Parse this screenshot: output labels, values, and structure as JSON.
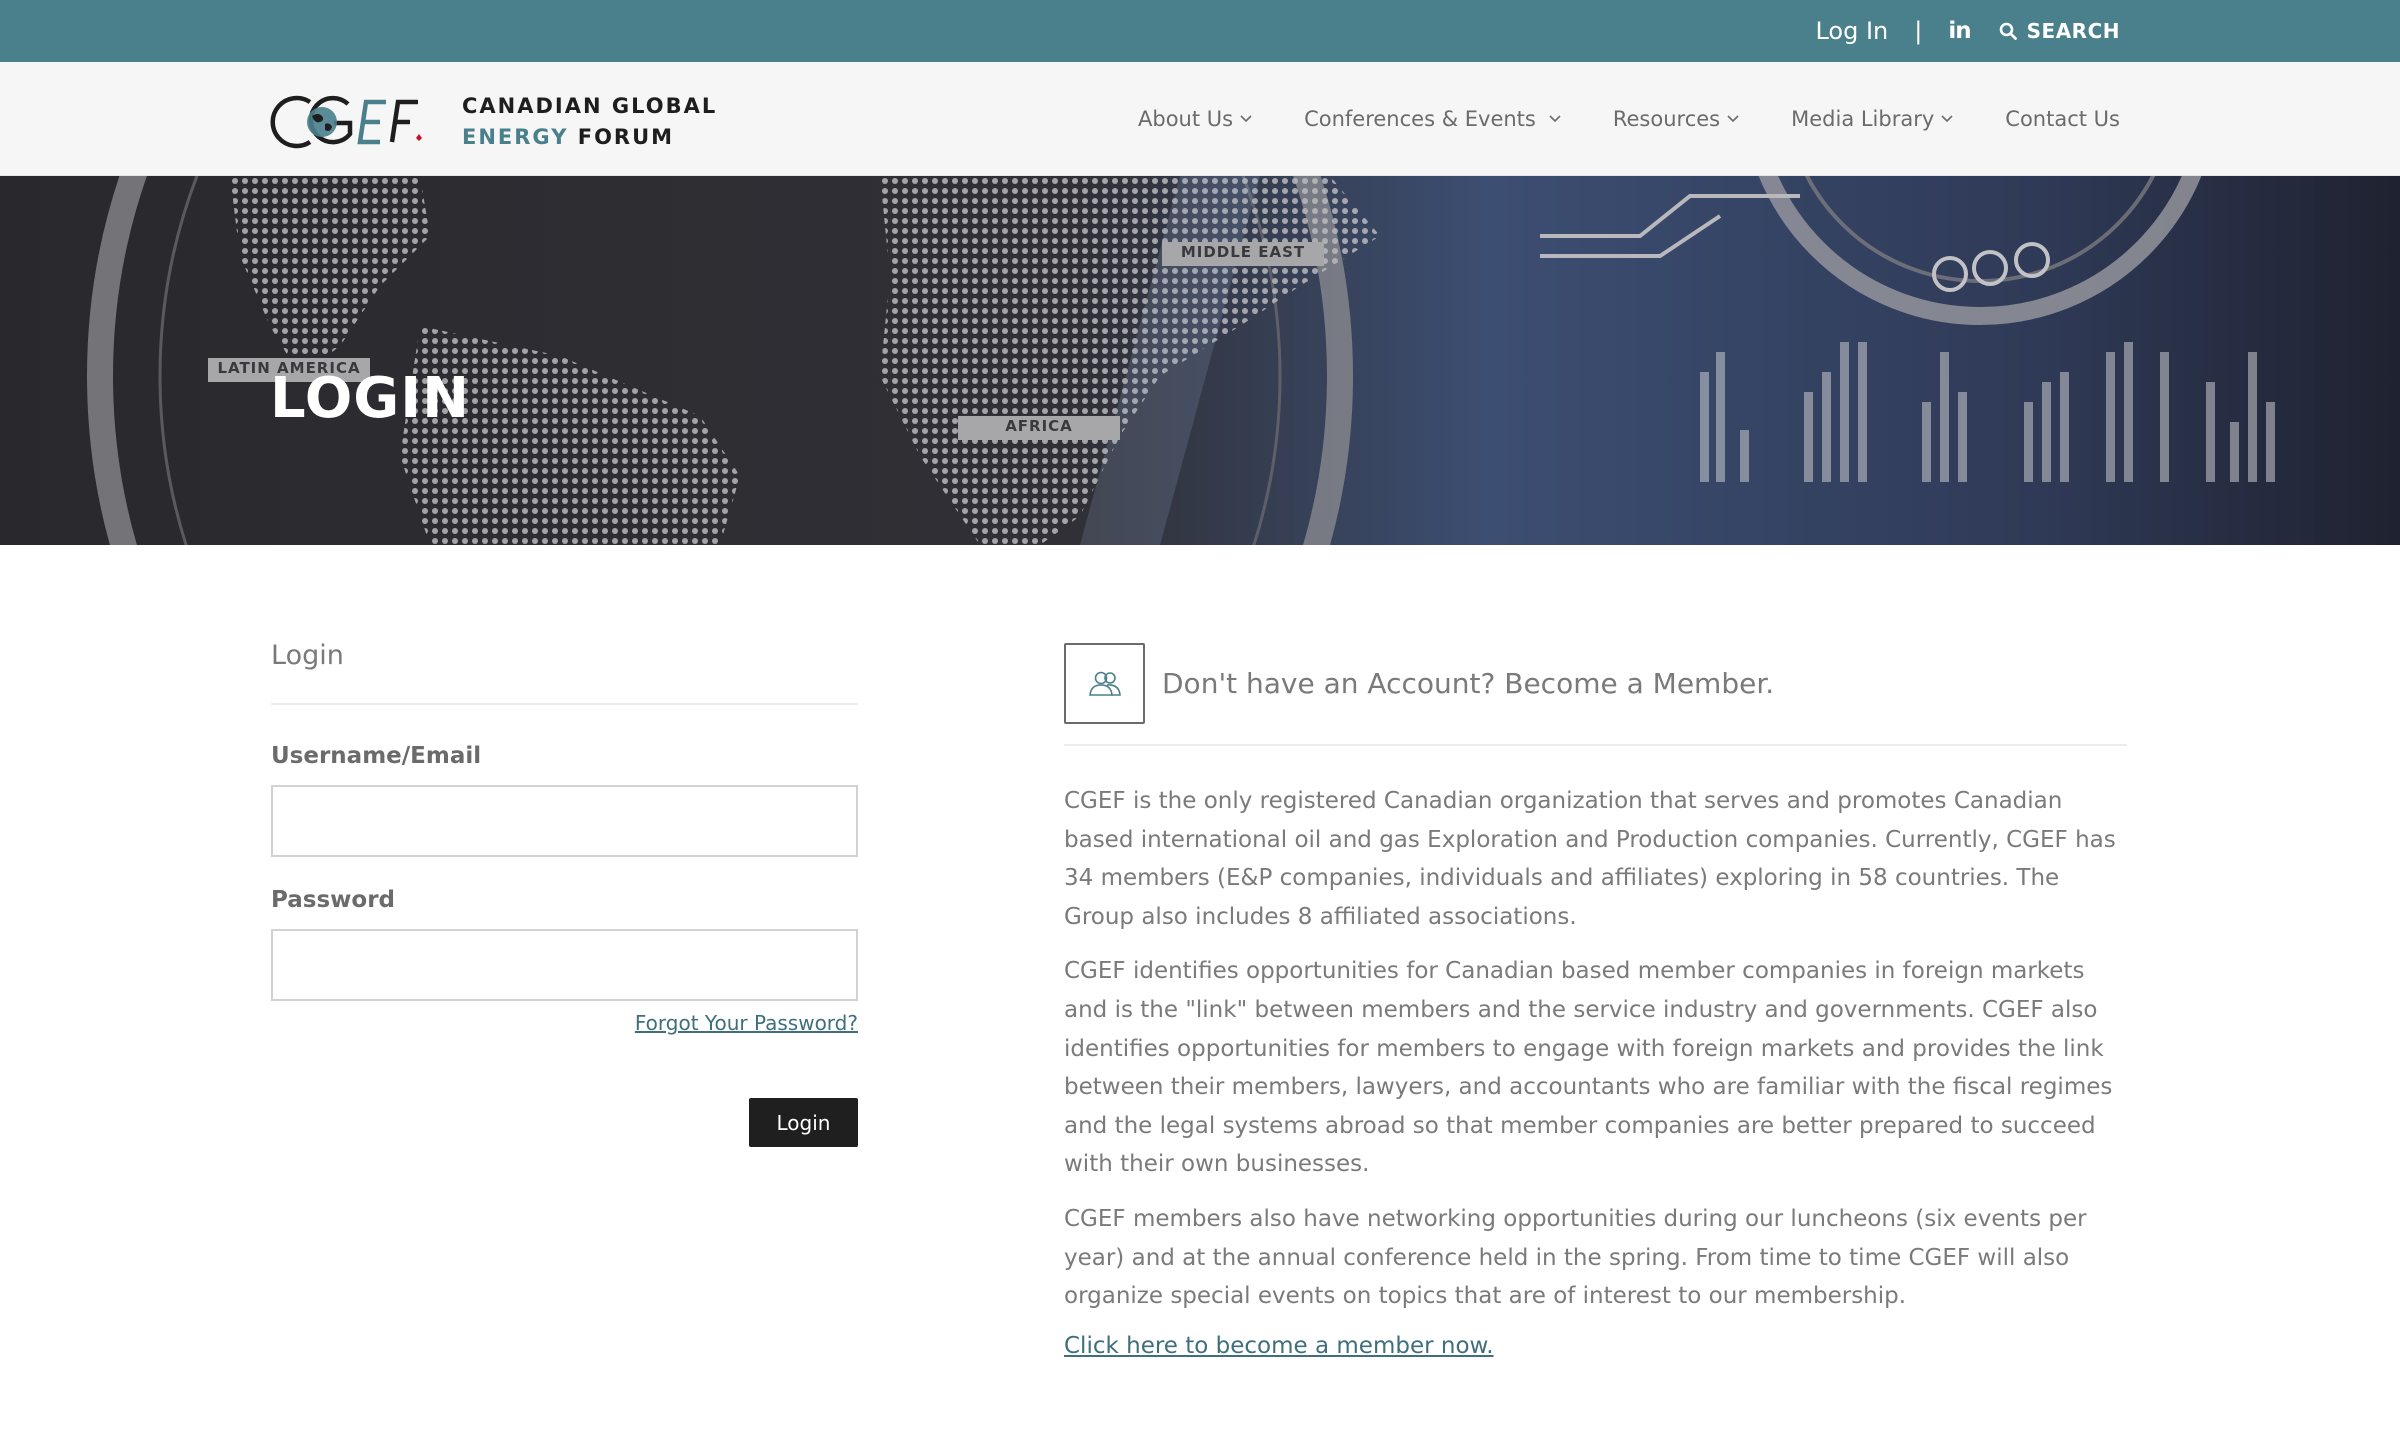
{
  "topbar": {
    "login_label": "Log In",
    "separator": "|",
    "linkedin_label": "in",
    "search_label": "SEARCH"
  },
  "header": {
    "logo_mark": "CGEF",
    "logo_line1": "CANADIAN GLOBAL",
    "logo_line2_accent": "ENERGY",
    "logo_line2_rest": "FORUM",
    "nav": [
      {
        "label": "About Us",
        "has_dropdown": true
      },
      {
        "label": "Conferences & Events",
        "has_dropdown": true
      },
      {
        "label": "Resources",
        "has_dropdown": true
      },
      {
        "label": "Media Library",
        "has_dropdown": true
      },
      {
        "label": "Contact Us",
        "has_dropdown": false
      }
    ]
  },
  "hero": {
    "title": "LOGIN",
    "map_labels": [
      "LATIN AMERICA",
      "MIDDLE EAST",
      "AFRICA"
    ]
  },
  "login": {
    "section_title": "Login",
    "username_label": "Username/Email",
    "username_value": "",
    "password_label": "Password",
    "password_value": "",
    "forgot_label": "Forgot Your Password?",
    "submit_label": "Login"
  },
  "membership": {
    "title": "Don't have an Account? Become a Member.",
    "paragraphs": [
      "CGEF is the only registered Canadian organization that serves and promotes Canadian based international oil and gas Exploration and Production companies. Currently, CGEF has 34 members (E&P companies, individuals and affiliates) exploring in 58 countries. The Group also includes 8 affiliated associations.",
      "CGEF identifies opportunities for Canadian based member companies in foreign markets and is the \"link\" between members and the service industry and governments. CGEF also identifies opportunities for members to engage with foreign markets and provides the link between their members, lawyers, and accountants who are familiar with the fiscal regimes and the legal systems abroad so that member companies are better prepared to succeed with their own businesses.",
      "CGEF members also have networking opportunities during our luncheons (six events per year) and at the annual conference held in the spring. From time to time CGEF will also organize special events on topics that are of interest to our membership."
    ],
    "link_label": "Click here to become a member now."
  },
  "colors": {
    "brand_teal": "#4a7f8c",
    "header_bg": "#f6f6f6",
    "button_dark": "#1f1f1f",
    "link": "#3f6f7c"
  }
}
